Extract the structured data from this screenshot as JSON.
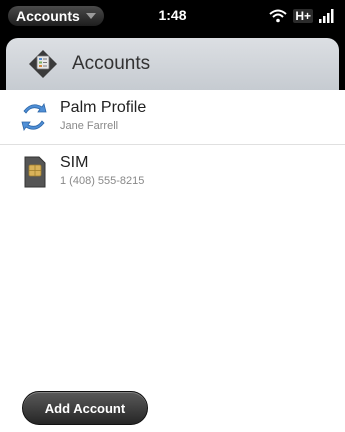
{
  "status_bar": {
    "app_name": "Accounts",
    "time": "1:48",
    "network": "H+"
  },
  "header": {
    "title": "Accounts",
    "icon": "accounts-app-icon"
  },
  "accounts": [
    {
      "title": "Palm Profile",
      "subtitle": "Jane Farrell",
      "icon": "palm-profile-sync-icon"
    },
    {
      "title": "SIM",
      "subtitle": "1 (408) 555-8215",
      "icon": "sim-card-icon"
    }
  ],
  "footer": {
    "add_button_label": "Add Account"
  },
  "colors": {
    "header_bg": "#c6cbd1",
    "status_bar_bg": "#000000",
    "button_bg": "#262626"
  }
}
